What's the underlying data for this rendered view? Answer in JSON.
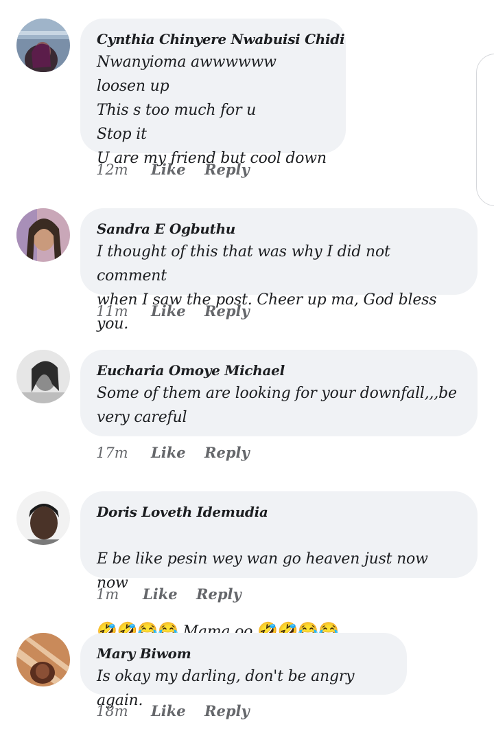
{
  "comments": [
    {
      "name": "Cynthia Chinyere Nwabuisi Chidi",
      "text": "Nwanyioma awwwwww loosen up\nThis s too much for u\nStop it\nU are my friend but cool down",
      "time": "12m",
      "like_label": "Like",
      "reply_label": "Reply"
    },
    {
      "name": "Sandra E Ogbuthu",
      "text": "I thought of this that was why I did not comment\nwhen I saw the post. Cheer up ma, God bless you.",
      "time": "11m",
      "like_label": "Like",
      "reply_label": "Reply"
    },
    {
      "name": "Eucharia Omoye Michael",
      "text": "Some of them are looking for your downfall,,,be\nvery careful",
      "time": "17m",
      "like_label": "Like",
      "reply_label": "Reply"
    },
    {
      "name": "Doris Loveth Idemudia",
      "text_line1": "E be like pesin wey wan go heaven just now now",
      "emoji_before": "🤣🤣😂😂",
      "text_mid": " Mama oo ",
      "emoji_after": "🤣🤣😂😂",
      "time": "1m",
      "like_label": "Like",
      "reply_label": "Reply"
    },
    {
      "name": "Mary Biwom",
      "text": "Is okay my darling, don't be angry again.",
      "time": "18m",
      "like_label": "Like",
      "reply_label": "Reply"
    }
  ],
  "colors": {
    "bubble": "#f0f2f5",
    "meta_text": "#65676b",
    "name_text": "#1c1e21"
  }
}
